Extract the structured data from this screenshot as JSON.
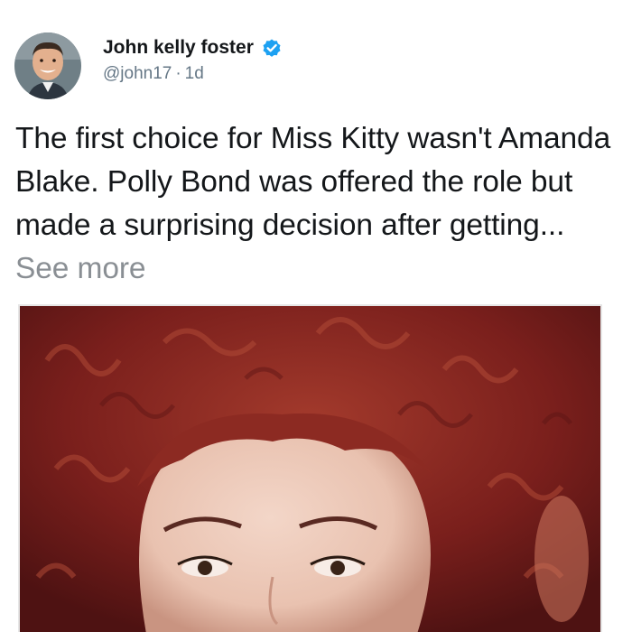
{
  "tweet": {
    "author": {
      "display_name": "John kelly foster",
      "handle": "@john17",
      "verified": true,
      "avatar_icon": "profile-photo"
    },
    "separator": "·",
    "timestamp": "1d",
    "body_text": "The first choice for Miss Kitty wasn't Amanda Blake. Polly Bond was offered the role but made a surprising decision after getting...",
    "see_more_label": "See more",
    "media": {
      "type": "photo"
    }
  },
  "colors": {
    "text_primary": "#14171a",
    "text_secondary": "#657786",
    "link_muted": "#8a8f94",
    "verified_badge": "#1da1f2",
    "photo_hair": "#7a1f1c"
  }
}
